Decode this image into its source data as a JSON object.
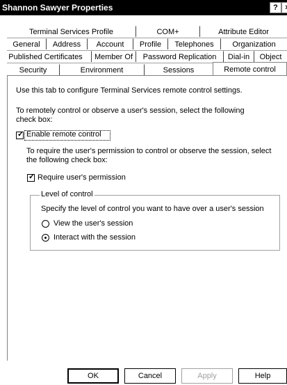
{
  "window": {
    "title": "Shannon Sawyer Properties",
    "help_glyph": "?",
    "close_glyph": "×"
  },
  "tabs": {
    "row1": [
      "Terminal Services Profile",
      "COM+",
      "Attribute Editor"
    ],
    "row2": [
      "General",
      "Address",
      "Account",
      "Profile",
      "Telephones",
      "Organization"
    ],
    "row3": [
      "Published Certificates",
      "Member Of",
      "Password Replication",
      "Dial-in",
      "Object"
    ],
    "row4": [
      "Security",
      "Environment",
      "Sessions",
      "Remote control"
    ],
    "active": "Remote control"
  },
  "content": {
    "intro": "Use this tab to configure Terminal Services remote control settings.",
    "remote_instruction": "To remotely control or observe a user's session, select the following check box:",
    "enable_remote_control": {
      "label": "Enable remote control",
      "checked": true
    },
    "permission_instruction": "To require the user's permission to control or observe the session, select the following check box:",
    "require_permission": {
      "label": "Require user's permission",
      "checked": true
    },
    "level_group": {
      "legend": "Level of control",
      "description": "Specify the level of control you want to have over a user's session",
      "options": [
        {
          "label": "View the user's session",
          "selected": false
        },
        {
          "label": "Interact with the session",
          "selected": true
        }
      ]
    }
  },
  "buttons": {
    "ok": "OK",
    "cancel": "Cancel",
    "apply": "Apply",
    "help": "Help"
  }
}
